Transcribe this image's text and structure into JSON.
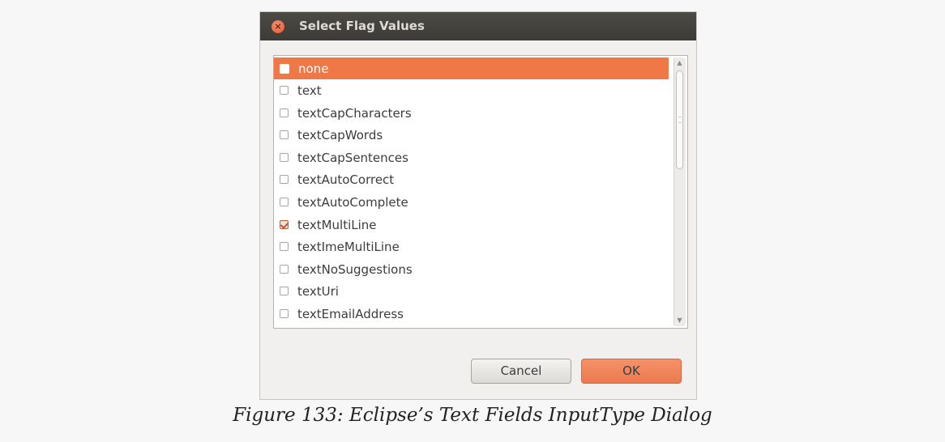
{
  "dialog": {
    "title": "Select Flag Values",
    "close_icon": "close-icon",
    "items": [
      {
        "label": "none",
        "checked": false,
        "selected": true
      },
      {
        "label": "text",
        "checked": false,
        "selected": false
      },
      {
        "label": "textCapCharacters",
        "checked": false,
        "selected": false
      },
      {
        "label": "textCapWords",
        "checked": false,
        "selected": false
      },
      {
        "label": "textCapSentences",
        "checked": false,
        "selected": false
      },
      {
        "label": "textAutoCorrect",
        "checked": false,
        "selected": false
      },
      {
        "label": "textAutoComplete",
        "checked": false,
        "selected": false
      },
      {
        "label": "textMultiLine",
        "checked": true,
        "selected": false
      },
      {
        "label": "textImeMultiLine",
        "checked": false,
        "selected": false
      },
      {
        "label": "textNoSuggestions",
        "checked": false,
        "selected": false
      },
      {
        "label": "textUri",
        "checked": false,
        "selected": false
      },
      {
        "label": "textEmailAddress",
        "checked": false,
        "selected": false
      }
    ],
    "cancel_label": "Cancel",
    "ok_label": "OK"
  },
  "caption": "Figure 133: Eclipse’s Text Fields InputType Dialog",
  "colors": {
    "accent": "#f07746",
    "titlebar": "#3c3b37"
  }
}
